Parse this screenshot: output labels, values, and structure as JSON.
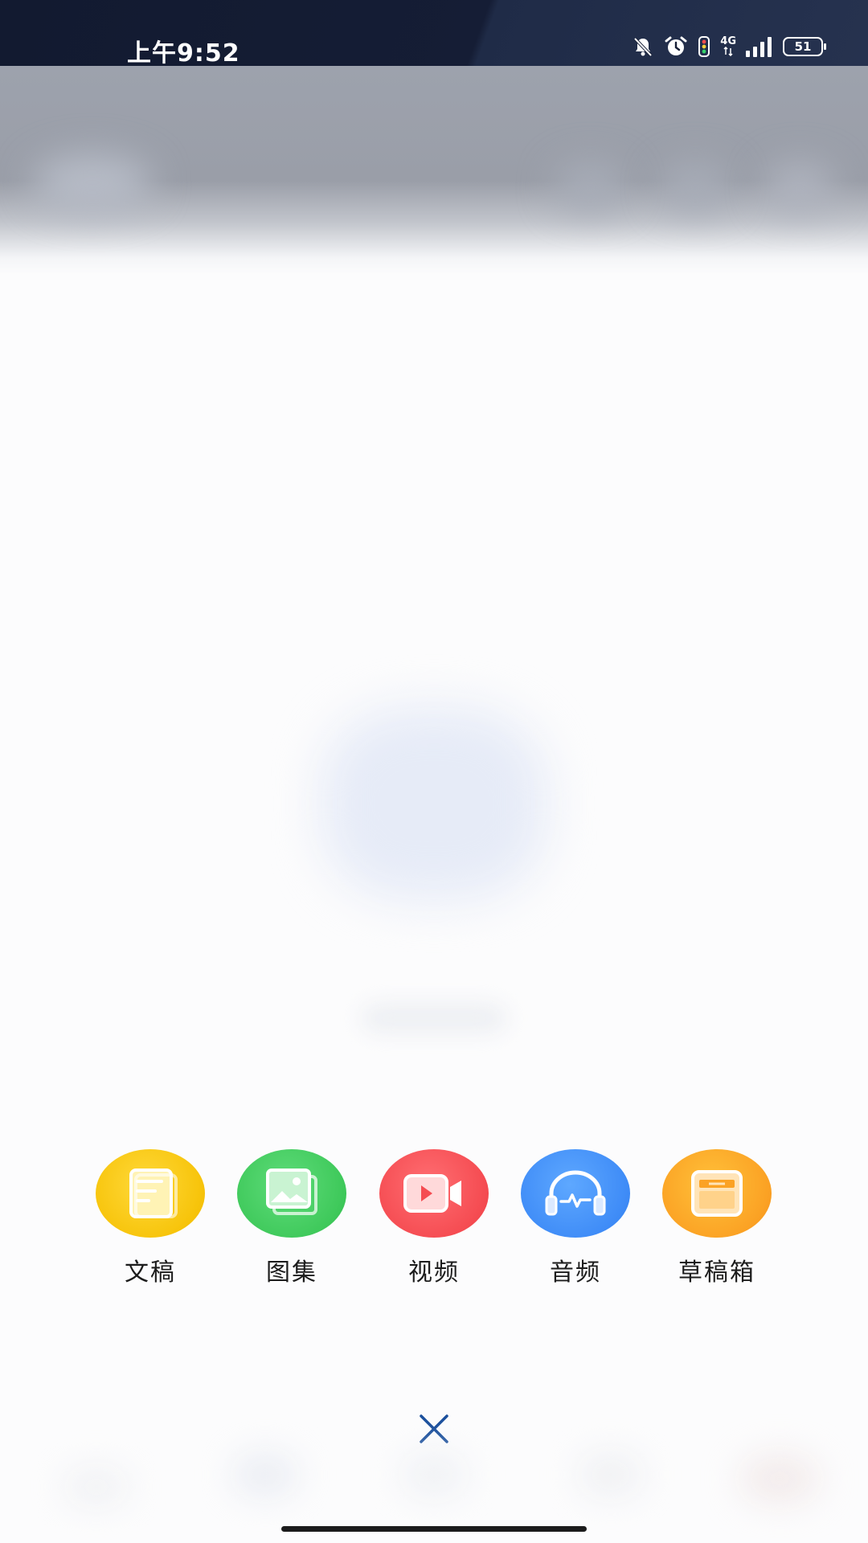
{
  "status_bar": {
    "time": "上午9:52",
    "network": "4G",
    "battery": "51"
  },
  "actions": [
    {
      "label": "文稿",
      "icon": "document-icon",
      "color": "#f7c40b"
    },
    {
      "label": "图集",
      "icon": "gallery-icon",
      "color": "#3fc95b"
    },
    {
      "label": "视频",
      "icon": "video-camera-icon",
      "color": "#f54c52"
    },
    {
      "label": "音频",
      "icon": "headphones-icon",
      "color": "#3f8cf7"
    },
    {
      "label": "草稿箱",
      "icon": "draft-box-icon",
      "color": "#fba224"
    }
  ],
  "close": {
    "icon": "close-icon",
    "color": "#1a4f9c"
  }
}
